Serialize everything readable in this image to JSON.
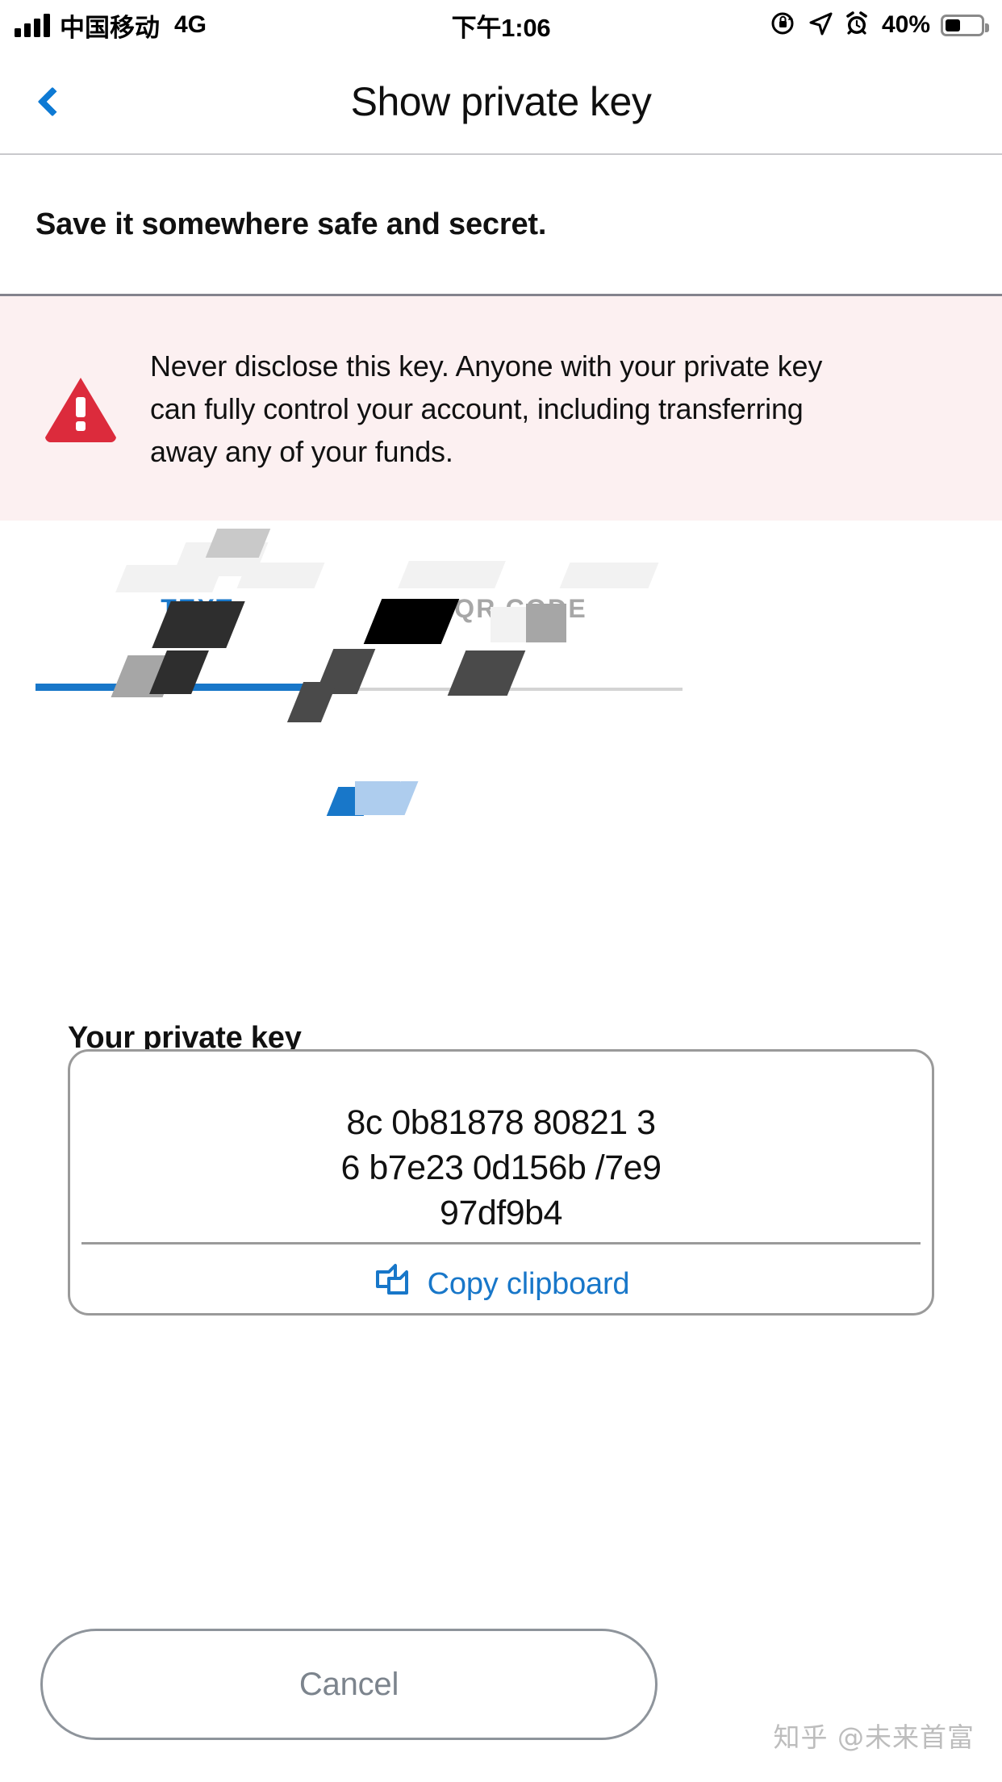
{
  "status_bar": {
    "carrier": "中国移动",
    "network": "4G",
    "time": "下午1:06",
    "battery_percent": "40%",
    "icons": [
      "signal-bars-icon",
      "rotation-lock-icon",
      "location-arrow-icon",
      "alarm-clock-icon",
      "battery-icon"
    ]
  },
  "nav": {
    "back_label": "back-chevron-icon",
    "title": "Show private key"
  },
  "subtitle": "Save it somewhere safe and secret.",
  "warning": {
    "icon": "warning-triangle-icon",
    "text": "Never disclose this key. Anyone with your private key can fully control your account, including transferring away any of your funds.",
    "bg_color": "#fcf0f1",
    "icon_color": "#dc2b3c"
  },
  "tabs": {
    "active_index": 0,
    "items": [
      {
        "label": "TEXT",
        "active": true
      },
      {
        "label": "QR CODE",
        "active": false
      }
    ],
    "active_color": "#1877c9",
    "inactive_color": "#a7a7a7"
  },
  "key_section": {
    "label": "Your private key",
    "key_lines": [
      "8c     0b81878  80821      3",
      "6    b7e23    0d156b    /7e9",
      "        97df9b4"
    ],
    "key_text": "8c     0b81878  80821      3\n6    b7e23    0d156b    /7e9\n        97df9b4",
    "copy_icon": "copy-documents-icon",
    "copy_label": "Copy        clipboard",
    "accent_color": "#1877c9"
  },
  "footer": {
    "cancel_label": "Cancel",
    "cancel_color": "#7c848d"
  },
  "watermark": "知乎 @未来首富"
}
